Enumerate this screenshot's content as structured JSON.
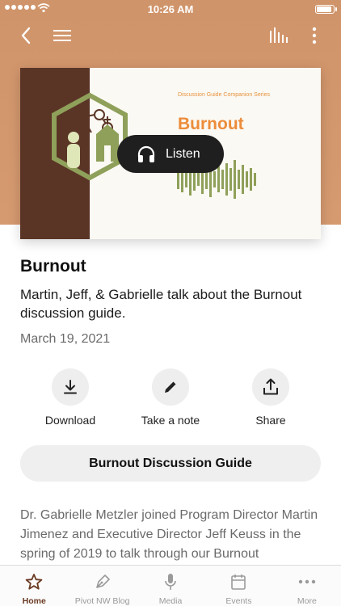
{
  "status_bar": {
    "time": "10:26 AM"
  },
  "nav": {
    "back_icon": "chevron-left-icon",
    "menu_icon": "hamburger-menu-icon",
    "audio_icon": "audio-bars-icon",
    "more_icon": "vertical-dots-icon"
  },
  "cover": {
    "series": "Discussion Guide Companion Series",
    "title": "Burnout",
    "colors": {
      "band": "#5a3526",
      "accent": "#ec8c3a",
      "green": "#8fa05a"
    }
  },
  "listen_button": {
    "label": "Listen",
    "icon": "headphones-icon"
  },
  "episode": {
    "title": "Burnout",
    "description": "Martin, Jeff, & Gabrielle talk about the Burnout discussion guide.",
    "date": "March 19, 2021",
    "body": "Dr. Gabrielle Metzler joined Program Director Martin Jimenez and Executive Director Jeff Keuss in the spring of 2019 to talk through our Burnout"
  },
  "actions": [
    {
      "label": "Download",
      "icon": "download-icon"
    },
    {
      "label": "Take a note",
      "icon": "pencil-icon"
    },
    {
      "label": "Share",
      "icon": "share-icon"
    }
  ],
  "guide_button": {
    "label": "Burnout Discussion Guide"
  },
  "tabs": [
    {
      "label": "Home",
      "icon": "star-icon",
      "active": true
    },
    {
      "label": "Pivot NW Blog",
      "icon": "pen-nib-icon",
      "active": false
    },
    {
      "label": "Media",
      "icon": "microphone-icon",
      "active": false
    },
    {
      "label": "Events",
      "icon": "calendar-icon",
      "active": false
    },
    {
      "label": "More",
      "icon": "more-dots-icon",
      "active": false
    }
  ],
  "theme": {
    "hero": "#d69a70",
    "active_tab": "#6a3a22"
  }
}
